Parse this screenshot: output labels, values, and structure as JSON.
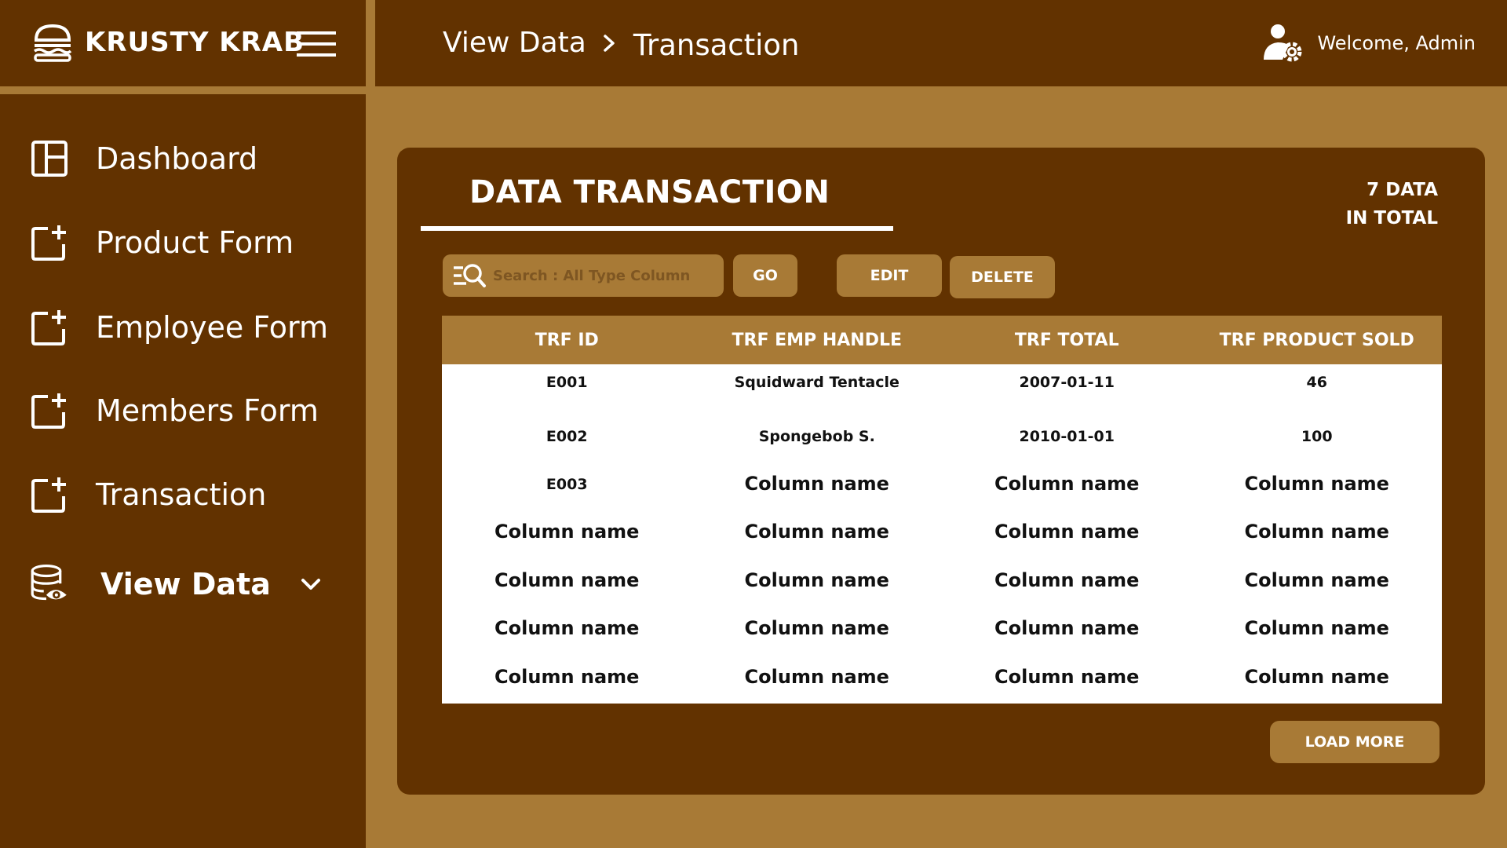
{
  "brand": {
    "name": "KRUSTY KRAB"
  },
  "sidebar": {
    "items": [
      {
        "label": "Dashboard",
        "icon": "dashboard-icon"
      },
      {
        "label": "Product Form",
        "icon": "add-form-icon"
      },
      {
        "label": "Employee Form",
        "icon": "add-form-icon"
      },
      {
        "label": "Members Form",
        "icon": "add-form-icon"
      },
      {
        "label": "Transaction",
        "icon": "add-form-icon"
      },
      {
        "label": "View Data",
        "icon": "database-view-icon",
        "expandable": true
      }
    ]
  },
  "header": {
    "breadcrumb": [
      "View Data",
      "Transaction"
    ],
    "welcome": "Welcome, Admin"
  },
  "card": {
    "title": "DATA TRANSACTION",
    "total_line1": "7 DATA",
    "total_line2": "IN TOTAL",
    "search_placeholder": "Search : All Type Column",
    "go_label": "GO",
    "edit_label": "EDIT",
    "delete_label": "DELETE",
    "load_more_label": "LOAD MORE"
  },
  "table": {
    "columns": [
      "TRF ID",
      "TRF EMP HANDLE",
      "TRF TOTAL",
      "TRF PRODUCT SOLD"
    ],
    "rows": [
      [
        "E001",
        "Squidward Tentacle",
        "2007-01-11",
        "46"
      ],
      [
        "E002",
        "Spongebob S.",
        "2010-01-01",
        "100"
      ],
      [
        "E003",
        "Column name",
        "Column name",
        "Column name"
      ],
      [
        "Column name",
        "Column name",
        "Column name",
        "Column name"
      ],
      [
        "Column name",
        "Column name",
        "Column name",
        "Column name"
      ],
      [
        "Column name",
        "Column name",
        "Column name",
        "Column name"
      ],
      [
        "Column name",
        "Column name",
        "Column name",
        "Column name"
      ]
    ]
  },
  "colors": {
    "dark_brown": "#623200",
    "gold": "#a87a36",
    "white": "#ffffff"
  }
}
